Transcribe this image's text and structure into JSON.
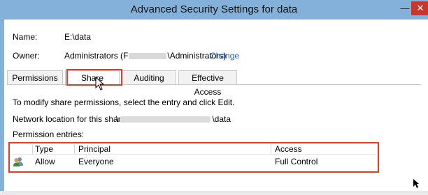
{
  "window": {
    "title": "Advanced Security Settings for data",
    "minimize": "—",
    "close": "✕"
  },
  "fields": {
    "name_label": "Name:",
    "name_value": "E:\\data",
    "owner_label": "Owner:",
    "owner_prefix": "Administrators (F",
    "owner_suffix": "\\Administrators)",
    "change_link": "Change"
  },
  "tabs": [
    {
      "label": "Permissions"
    },
    {
      "label": "Share"
    },
    {
      "label": "Auditing"
    },
    {
      "label": "Effective Access"
    }
  ],
  "share": {
    "instruction": "To modify share permissions, select the entry and click Edit.",
    "network_label": "Network location for this share:",
    "network_prefix": "\\",
    "network_suffix": "\\data",
    "entries_label": "Permission entries:"
  },
  "table": {
    "columns": [
      "Type",
      "Principal",
      "Access"
    ],
    "rows": [
      {
        "type": "Allow",
        "principal": "Everyone",
        "access": "Full Control"
      }
    ]
  },
  "icons": [
    "user-group-icon",
    "mouse-cursor-icon"
  ],
  "colors": {
    "titlebar": "#84b1d9",
    "highlight": "#e03a2f",
    "link": "#1f5fb9",
    "close": "#c7362c"
  }
}
